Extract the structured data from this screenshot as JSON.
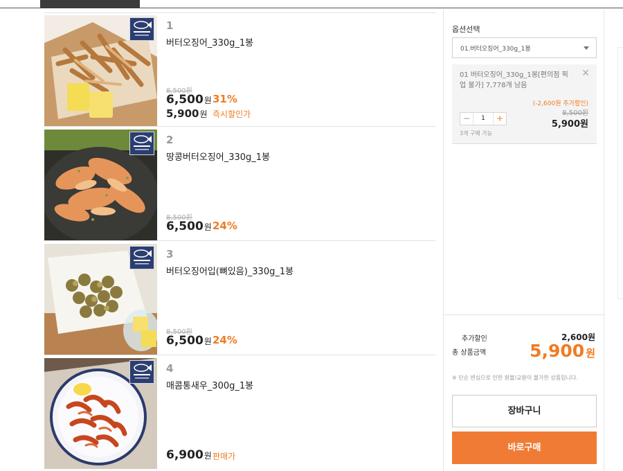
{
  "products": [
    {
      "num": "1",
      "name": "버터오징어_330g_1봉",
      "orig_price": "8,500원",
      "price": "6,500",
      "won": "원",
      "rate": "31%",
      "price2": "5,900",
      "tag": "즉시할인가"
    },
    {
      "num": "2",
      "name": "땅콩버터오징어_330g_1봉",
      "orig_price": "8,500원",
      "price": "6,500",
      "won": "원",
      "rate": "24%"
    },
    {
      "num": "3",
      "name": "버터오징어입(뼈있음)_330g_1봉",
      "orig_price": "8,500원",
      "price": "6,500",
      "won": "원",
      "rate": "24%"
    },
    {
      "num": "4",
      "name": "매콤통새우_300g_1봉",
      "price": "6,900",
      "won": "원",
      "tag": "판매가"
    }
  ],
  "option": {
    "label": "옵션선택",
    "select_value": "01.버터오징어_330g_1봉",
    "item_title": "01 버터오징어_330g_1봉[편의점 픽업 불가]  7,778개 남음",
    "extra_discount": "(-2,600원 추가할인)",
    "orig_price": "8,500원",
    "final_price": "5,900원",
    "quantity": "1",
    "limit": "3개 구매 가능"
  },
  "summary": {
    "extra_label": "추가할인",
    "extra_value": "2,600원",
    "total_label": "총 상품금액",
    "total_value": "5,900",
    "total_unit": "원",
    "notice": "※ 단순 변심으로 인한 환불/교환이 불가한 상품입니다.",
    "cart_button": "장바구니",
    "buy_button": "바로구매"
  },
  "colors": {
    "accent": "#f07b22",
    "buy_button": "#f07b34",
    "badge": "#2c3e70"
  },
  "icons": {
    "close": "close-icon",
    "minus": "minus-icon",
    "plus": "plus-icon",
    "caret": "chevron-down-icon"
  }
}
